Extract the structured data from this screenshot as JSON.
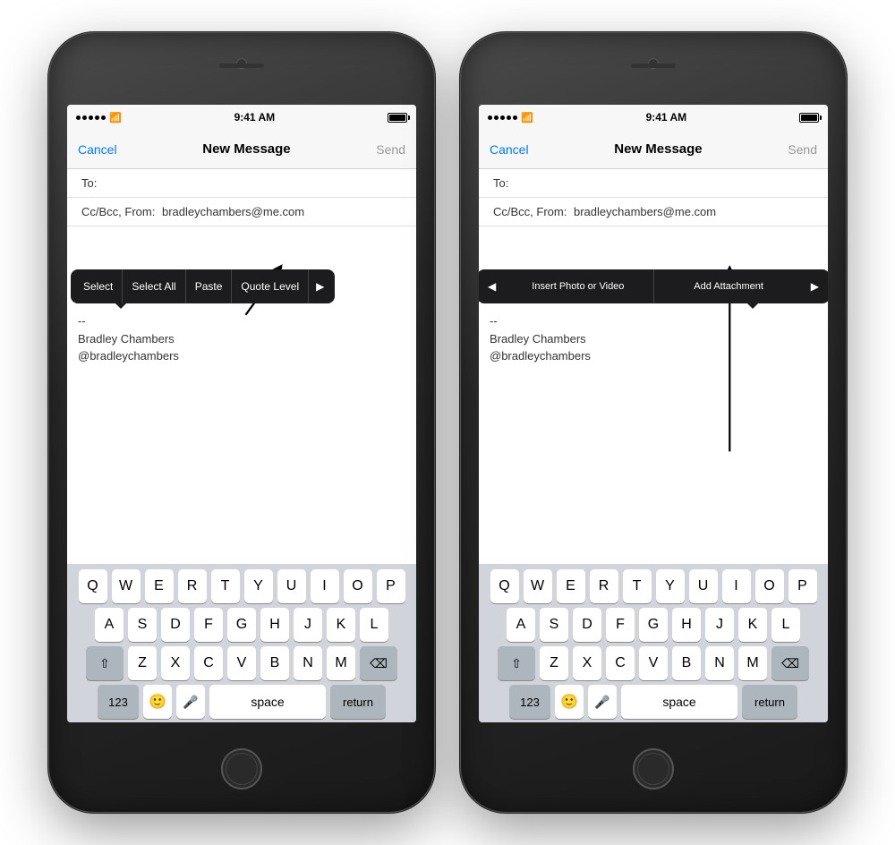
{
  "phone1": {
    "status": {
      "signal": "●●●●●",
      "wifi": "WiFi",
      "time": "9:41 AM",
      "battery": "full"
    },
    "nav": {
      "cancel": "Cancel",
      "title": "New Message",
      "send": "Send"
    },
    "fields": {
      "to_label": "To:",
      "ccbcc_label": "Cc/Bcc, From:",
      "from_email": "bradleychambers@me.com"
    },
    "context_menu": {
      "select": "Select",
      "select_all": "Select All",
      "paste": "Paste",
      "quote_level": "Quote Level",
      "arrow": "▶"
    },
    "signature": {
      "dash": "--",
      "name": "Bradley Chambers",
      "handle": "@bradleychambers"
    },
    "keyboard": {
      "row1": [
        "Q",
        "W",
        "E",
        "R",
        "T",
        "Y",
        "U",
        "I",
        "O",
        "P"
      ],
      "row2": [
        "A",
        "S",
        "D",
        "F",
        "G",
        "H",
        "J",
        "K",
        "L"
      ],
      "row3": [
        "Z",
        "X",
        "C",
        "V",
        "B",
        "N",
        "M"
      ],
      "bottom": {
        "num": "123",
        "space": "space",
        "return": "return"
      }
    }
  },
  "phone2": {
    "status": {
      "time": "9:41 AM"
    },
    "nav": {
      "cancel": "Cancel",
      "title": "New Message",
      "send": "Send"
    },
    "fields": {
      "to_label": "To:",
      "ccbcc_label": "Cc/Bcc, From:",
      "from_email": "bradleychambers@me.com"
    },
    "context_menu": {
      "arrow_left": "◀",
      "insert_photo": "Insert Photo or Video",
      "add_attachment": "Add Attachment",
      "arrow_right": "▶"
    },
    "signature": {
      "dash": "--",
      "name": "Bradley Chambers",
      "handle": "@bradleychambers"
    }
  }
}
